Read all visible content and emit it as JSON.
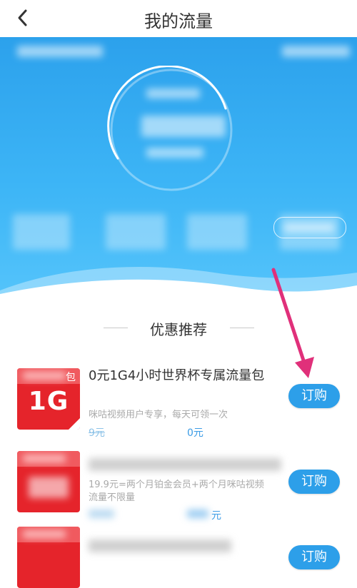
{
  "header": {
    "title": "我的流量",
    "back_icon": "chevron-left-icon"
  },
  "hero": {
    "colors": {
      "top": "#2ca1ec",
      "bottom": "#56c5fb"
    }
  },
  "section": {
    "title": "优惠推荐"
  },
  "items": [
    {
      "thumb_big": "1G",
      "thumb_corner": "包",
      "title": "0元1G4小时世界杯专属流量包",
      "desc": "咪咕视频用户专享，每天可领一次",
      "price_old": "9元",
      "price_new": "0元",
      "button": "订购"
    },
    {
      "desc_line1": "19.9元=两个月铂金会员+两个月咪咕视频",
      "desc_line2": "流量不限量",
      "price_new_suffix": "元",
      "button": "订购"
    },
    {
      "button": "订购"
    }
  ],
  "accent": {
    "button": "#2d9fe9",
    "arrow": "#e0307a"
  }
}
